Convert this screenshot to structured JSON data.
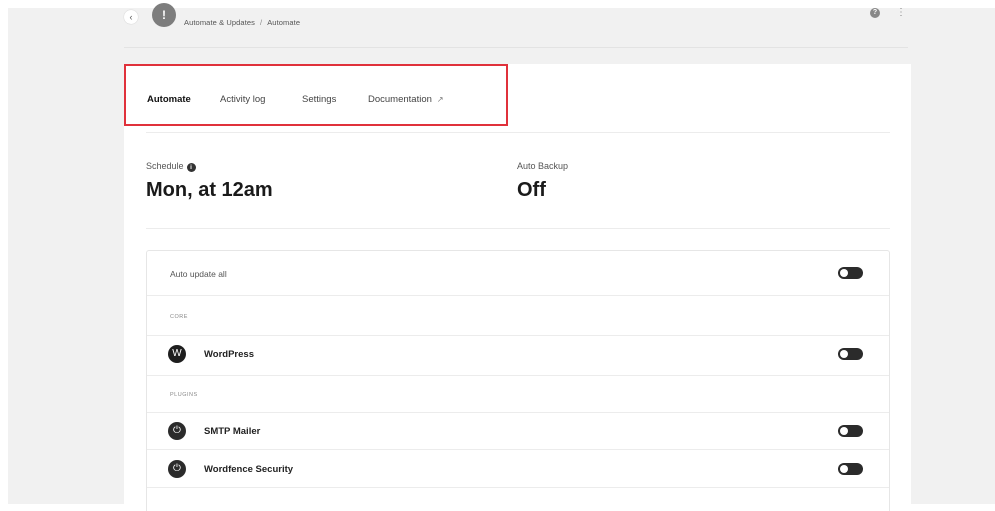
{
  "header": {
    "back_glyph": "‹",
    "site_initial": "!",
    "breadcrumb": [
      "Automate & Updates",
      "Automate"
    ],
    "breadcrumb_separator": "/",
    "help_glyph": "?",
    "more_glyph": "⋮"
  },
  "tabs": [
    {
      "label": "Automate",
      "active": true
    },
    {
      "label": "Activity log",
      "active": false
    },
    {
      "label": "Settings",
      "active": false
    },
    {
      "label": "Documentation",
      "active": false,
      "external": true
    }
  ],
  "external_glyph": "↗",
  "stats": {
    "schedule": {
      "label": "Schedule",
      "info_glyph": "i",
      "value": "Mon, at 12am"
    },
    "auto_backup": {
      "label": "Auto Backup",
      "value": "Off"
    }
  },
  "auto_update_all": {
    "label": "Auto update all",
    "enabled": false
  },
  "sections": {
    "core": {
      "label": "CORE",
      "items": [
        {
          "name": "WordPress",
          "icon": "wordpress-icon",
          "glyph": "W",
          "enabled": false
        }
      ]
    },
    "plugins": {
      "label": "PLUGINS",
      "items": [
        {
          "name": "SMTP Mailer",
          "icon": "plug-icon",
          "glyph": "⏻",
          "enabled": false
        },
        {
          "name": "Wordfence Security",
          "icon": "plug-icon",
          "glyph": "⏻",
          "enabled": false
        }
      ]
    }
  },
  "colors": {
    "highlight": "#e0313b",
    "toggle_off": "#2b2b2b",
    "background": "#f1f1f1"
  }
}
